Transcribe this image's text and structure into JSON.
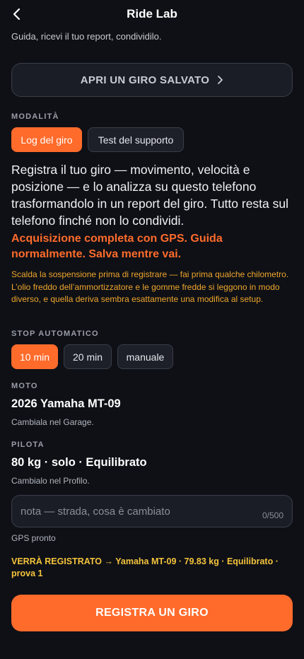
{
  "header": {
    "title": "Ride Lab",
    "back_icon": "chevron-left-icon"
  },
  "subtitle": "Guida, ricevi il tuo report, condividilo.",
  "open_saved": {
    "label": "APRI UN GIRO SALVATO",
    "icon": "chevron-right-icon"
  },
  "mode": {
    "label": "MODALITÀ",
    "options": [
      {
        "label": "Log del giro",
        "selected": true
      },
      {
        "label": "Test del supporto",
        "selected": false
      }
    ]
  },
  "description": "Registra il tuo giro — movimento, velocità e posizione — e lo analizza su questo telefono trasformandolo in un report del giro. Tutto resta sul telefono finché non lo condividi.",
  "gps_headline": "Acquisizione completa con GPS. Guida normalmente. Salva mentre vai.",
  "warning": "Scalda la sospensione prima di registrare — fai prima qualche chilometro. L’olio freddo dell’ammortizzatore e le gomme fredde si leggono in modo diverso, e quella deriva sembra esattamente una modifica al setup.",
  "auto_stop": {
    "label": "STOP AUTOMATICO",
    "options": [
      {
        "label": "10 min",
        "selected": true
      },
      {
        "label": "20 min",
        "selected": false
      },
      {
        "label": "manuale",
        "selected": false
      }
    ]
  },
  "bike": {
    "label": "MOTO",
    "value": "2026 Yamaha MT-09",
    "hint": "Cambiala nel Garage."
  },
  "rider": {
    "label": "PILOTA",
    "value": "80 kg · solo · Equilibrato",
    "hint": "Cambialo nel Profilo."
  },
  "note": {
    "value": "",
    "placeholder": "nota — strada, cosa è cambiato",
    "counter": "0/500"
  },
  "gps_status": "GPS pronto",
  "will_record": "VERRÀ REGISTRATO → Yamaha MT-09 · 79.83 kg · Equilibrato · prova 1",
  "record_button": "REGISTRA UN GIRO",
  "colors": {
    "background": "#0e1016",
    "accent": "#ff6b2b",
    "warning": "#f0a62c",
    "highlight": "#f5c33b"
  }
}
